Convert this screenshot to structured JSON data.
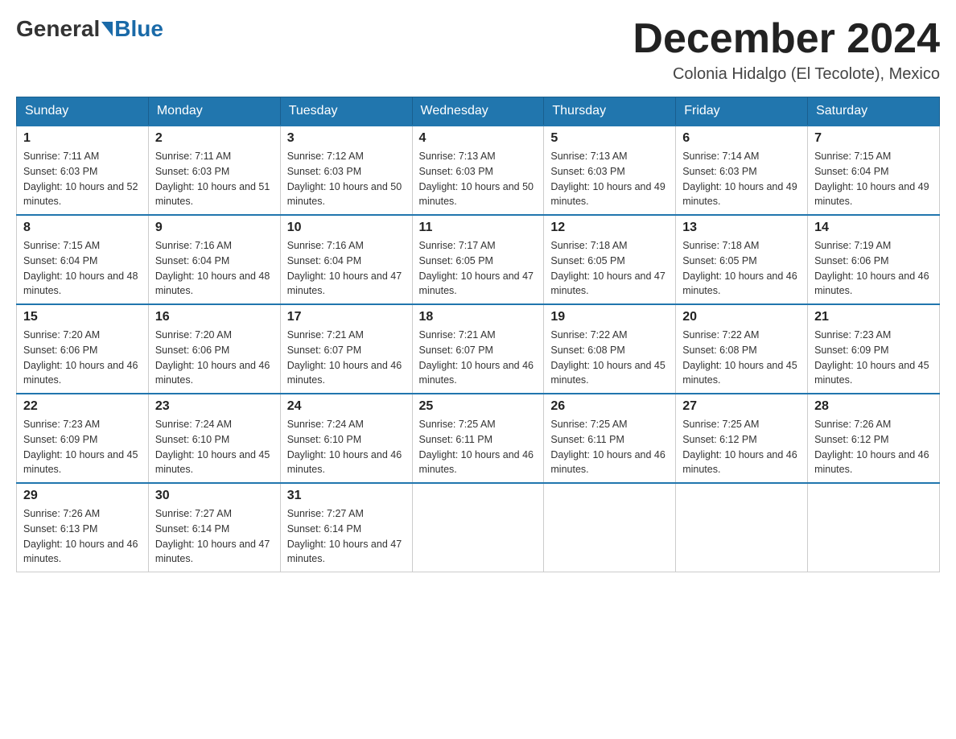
{
  "header": {
    "logo_general": "General",
    "logo_blue": "Blue",
    "title": "December 2024",
    "location": "Colonia Hidalgo (El Tecolote), Mexico"
  },
  "weekdays": [
    "Sunday",
    "Monday",
    "Tuesday",
    "Wednesday",
    "Thursday",
    "Friday",
    "Saturday"
  ],
  "weeks": [
    [
      {
        "day": "1",
        "sunrise": "Sunrise: 7:11 AM",
        "sunset": "Sunset: 6:03 PM",
        "daylight": "Daylight: 10 hours and 52 minutes."
      },
      {
        "day": "2",
        "sunrise": "Sunrise: 7:11 AM",
        "sunset": "Sunset: 6:03 PM",
        "daylight": "Daylight: 10 hours and 51 minutes."
      },
      {
        "day": "3",
        "sunrise": "Sunrise: 7:12 AM",
        "sunset": "Sunset: 6:03 PM",
        "daylight": "Daylight: 10 hours and 50 minutes."
      },
      {
        "day": "4",
        "sunrise": "Sunrise: 7:13 AM",
        "sunset": "Sunset: 6:03 PM",
        "daylight": "Daylight: 10 hours and 50 minutes."
      },
      {
        "day": "5",
        "sunrise": "Sunrise: 7:13 AM",
        "sunset": "Sunset: 6:03 PM",
        "daylight": "Daylight: 10 hours and 49 minutes."
      },
      {
        "day": "6",
        "sunrise": "Sunrise: 7:14 AM",
        "sunset": "Sunset: 6:03 PM",
        "daylight": "Daylight: 10 hours and 49 minutes."
      },
      {
        "day": "7",
        "sunrise": "Sunrise: 7:15 AM",
        "sunset": "Sunset: 6:04 PM",
        "daylight": "Daylight: 10 hours and 49 minutes."
      }
    ],
    [
      {
        "day": "8",
        "sunrise": "Sunrise: 7:15 AM",
        "sunset": "Sunset: 6:04 PM",
        "daylight": "Daylight: 10 hours and 48 minutes."
      },
      {
        "day": "9",
        "sunrise": "Sunrise: 7:16 AM",
        "sunset": "Sunset: 6:04 PM",
        "daylight": "Daylight: 10 hours and 48 minutes."
      },
      {
        "day": "10",
        "sunrise": "Sunrise: 7:16 AM",
        "sunset": "Sunset: 6:04 PM",
        "daylight": "Daylight: 10 hours and 47 minutes."
      },
      {
        "day": "11",
        "sunrise": "Sunrise: 7:17 AM",
        "sunset": "Sunset: 6:05 PM",
        "daylight": "Daylight: 10 hours and 47 minutes."
      },
      {
        "day": "12",
        "sunrise": "Sunrise: 7:18 AM",
        "sunset": "Sunset: 6:05 PM",
        "daylight": "Daylight: 10 hours and 47 minutes."
      },
      {
        "day": "13",
        "sunrise": "Sunrise: 7:18 AM",
        "sunset": "Sunset: 6:05 PM",
        "daylight": "Daylight: 10 hours and 46 minutes."
      },
      {
        "day": "14",
        "sunrise": "Sunrise: 7:19 AM",
        "sunset": "Sunset: 6:06 PM",
        "daylight": "Daylight: 10 hours and 46 minutes."
      }
    ],
    [
      {
        "day": "15",
        "sunrise": "Sunrise: 7:20 AM",
        "sunset": "Sunset: 6:06 PM",
        "daylight": "Daylight: 10 hours and 46 minutes."
      },
      {
        "day": "16",
        "sunrise": "Sunrise: 7:20 AM",
        "sunset": "Sunset: 6:06 PM",
        "daylight": "Daylight: 10 hours and 46 minutes."
      },
      {
        "day": "17",
        "sunrise": "Sunrise: 7:21 AM",
        "sunset": "Sunset: 6:07 PM",
        "daylight": "Daylight: 10 hours and 46 minutes."
      },
      {
        "day": "18",
        "sunrise": "Sunrise: 7:21 AM",
        "sunset": "Sunset: 6:07 PM",
        "daylight": "Daylight: 10 hours and 46 minutes."
      },
      {
        "day": "19",
        "sunrise": "Sunrise: 7:22 AM",
        "sunset": "Sunset: 6:08 PM",
        "daylight": "Daylight: 10 hours and 45 minutes."
      },
      {
        "day": "20",
        "sunrise": "Sunrise: 7:22 AM",
        "sunset": "Sunset: 6:08 PM",
        "daylight": "Daylight: 10 hours and 45 minutes."
      },
      {
        "day": "21",
        "sunrise": "Sunrise: 7:23 AM",
        "sunset": "Sunset: 6:09 PM",
        "daylight": "Daylight: 10 hours and 45 minutes."
      }
    ],
    [
      {
        "day": "22",
        "sunrise": "Sunrise: 7:23 AM",
        "sunset": "Sunset: 6:09 PM",
        "daylight": "Daylight: 10 hours and 45 minutes."
      },
      {
        "day": "23",
        "sunrise": "Sunrise: 7:24 AM",
        "sunset": "Sunset: 6:10 PM",
        "daylight": "Daylight: 10 hours and 45 minutes."
      },
      {
        "day": "24",
        "sunrise": "Sunrise: 7:24 AM",
        "sunset": "Sunset: 6:10 PM",
        "daylight": "Daylight: 10 hours and 46 minutes."
      },
      {
        "day": "25",
        "sunrise": "Sunrise: 7:25 AM",
        "sunset": "Sunset: 6:11 PM",
        "daylight": "Daylight: 10 hours and 46 minutes."
      },
      {
        "day": "26",
        "sunrise": "Sunrise: 7:25 AM",
        "sunset": "Sunset: 6:11 PM",
        "daylight": "Daylight: 10 hours and 46 minutes."
      },
      {
        "day": "27",
        "sunrise": "Sunrise: 7:25 AM",
        "sunset": "Sunset: 6:12 PM",
        "daylight": "Daylight: 10 hours and 46 minutes."
      },
      {
        "day": "28",
        "sunrise": "Sunrise: 7:26 AM",
        "sunset": "Sunset: 6:12 PM",
        "daylight": "Daylight: 10 hours and 46 minutes."
      }
    ],
    [
      {
        "day": "29",
        "sunrise": "Sunrise: 7:26 AM",
        "sunset": "Sunset: 6:13 PM",
        "daylight": "Daylight: 10 hours and 46 minutes."
      },
      {
        "day": "30",
        "sunrise": "Sunrise: 7:27 AM",
        "sunset": "Sunset: 6:14 PM",
        "daylight": "Daylight: 10 hours and 47 minutes."
      },
      {
        "day": "31",
        "sunrise": "Sunrise: 7:27 AM",
        "sunset": "Sunset: 6:14 PM",
        "daylight": "Daylight: 10 hours and 47 minutes."
      },
      null,
      null,
      null,
      null
    ]
  ]
}
